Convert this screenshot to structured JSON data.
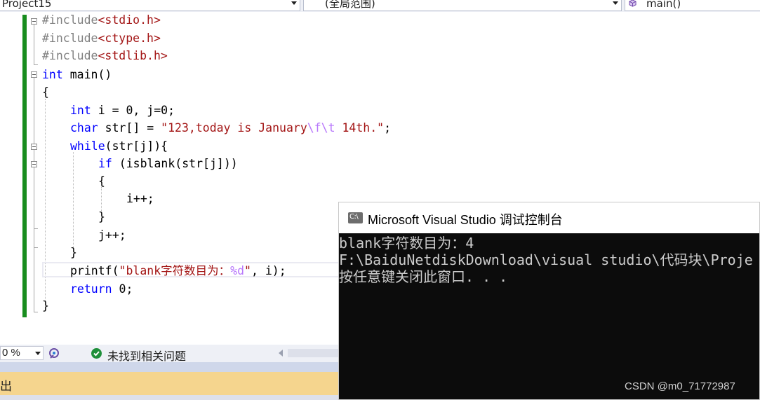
{
  "nav": {
    "project": "Project15",
    "scope": "(全局范围)",
    "member": "main()"
  },
  "code": {
    "l1": {
      "pp": "#include",
      "arg": "<stdio.h>"
    },
    "l2": {
      "pp": "#include",
      "arg": "<ctype.h>"
    },
    "l3": {
      "pp": "#include",
      "arg": "<stdlib.h>"
    },
    "l4": {
      "kw": "int",
      "rest": " main()"
    },
    "l5": "{",
    "l6": {
      "kw": "int",
      "rest": " i = 0, j=0;"
    },
    "l7": {
      "kw": "char",
      "a": " str[] = ",
      "s1": "\"123,today is January",
      "e": "\\f\\t",
      "s2": " 14th.\"",
      "end": ";"
    },
    "l8": {
      "kw": "while",
      "rest": "(str[j]){"
    },
    "l9": {
      "kw": "if",
      "rest": " (isblank(str[j]))"
    },
    "l10": "{",
    "l11": "i++;",
    "l12": "}",
    "l13": "j++;",
    "l14": "}",
    "l15": {
      "a": "printf(",
      "s": "\"blank字符数目为：",
      "f": "%d",
      "s2": "\"",
      "end": ", i);"
    },
    "l16": {
      "kw": "return",
      "rest": " 0;"
    },
    "l17": "}"
  },
  "status": {
    "zoom": "0 %",
    "message": "未找到相关问题"
  },
  "output_panel": {
    "label": "出"
  },
  "console": {
    "title": "Microsoft Visual Studio 调试控制台",
    "icon_text": "C:\\",
    "lines": [
      "blank字符数目为：4",
      "F:\\BaiduNetdiskDownload\\visual studio\\代码块\\Proje",
      "按任意键关闭此窗口. . ."
    ]
  },
  "watermark": "CSDN @m0_71772987",
  "colors": {
    "keyword": "#0000ff",
    "preprocessor": "#808080",
    "string": "#a31515",
    "escape": "#b776fb",
    "change_bar": "#188d1e",
    "output_bar": "#f5d58e"
  }
}
